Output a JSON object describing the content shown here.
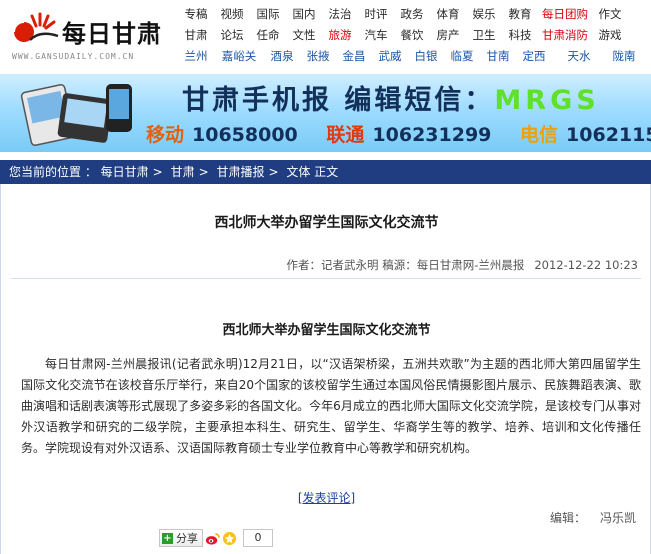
{
  "header": {
    "logo_brand": "每日甘肃",
    "logo_domain": "WWW.GANSUDAILY.COM.CN",
    "nav_rows": [
      [
        {
          "label": "专稿",
          "style": ""
        },
        {
          "label": "视频",
          "style": ""
        },
        {
          "label": "国际",
          "style": ""
        },
        {
          "label": "国内",
          "style": ""
        },
        {
          "label": "法治",
          "style": ""
        },
        {
          "label": "时评",
          "style": ""
        },
        {
          "label": "政务",
          "style": ""
        },
        {
          "label": "体育",
          "style": ""
        },
        {
          "label": "娱乐",
          "style": ""
        },
        {
          "label": "教育",
          "style": ""
        },
        {
          "label": "每日团购",
          "style": "red w3"
        },
        {
          "label": "作文",
          "style": ""
        }
      ],
      [
        {
          "label": "甘肃",
          "style": ""
        },
        {
          "label": "论坛",
          "style": ""
        },
        {
          "label": "任命",
          "style": ""
        },
        {
          "label": "文性",
          "style": ""
        },
        {
          "label": "旅游",
          "style": "red"
        },
        {
          "label": "汽车",
          "style": ""
        },
        {
          "label": "餐饮",
          "style": ""
        },
        {
          "label": "房产",
          "style": ""
        },
        {
          "label": "卫生",
          "style": ""
        },
        {
          "label": "科技",
          "style": ""
        },
        {
          "label": "甘肃消防",
          "style": "red w3"
        },
        {
          "label": "游戏",
          "style": ""
        }
      ],
      [
        {
          "label": "兰州",
          "style": "blue"
        },
        {
          "label": "嘉峪关",
          "style": "blue w2"
        },
        {
          "label": "酒泉",
          "style": "blue"
        },
        {
          "label": "张掖",
          "style": "blue"
        },
        {
          "label": "金昌",
          "style": "blue"
        },
        {
          "label": "武威",
          "style": "blue"
        },
        {
          "label": "白银",
          "style": "blue"
        },
        {
          "label": "临夏",
          "style": "blue"
        },
        {
          "label": "甘南",
          "style": "blue"
        },
        {
          "label": "定西",
          "style": "blue"
        },
        {
          "label": "天水",
          "style": "blue w3"
        },
        {
          "label": "陇南",
          "style": "blue"
        }
      ]
    ]
  },
  "banner": {
    "headline": "甘肃手机报  编辑短信：",
    "code": "MRGS",
    "carriers": [
      {
        "name": "移动",
        "number": "10658000"
      },
      {
        "name": "联通",
        "number": "106231299"
      },
      {
        "name": "电信",
        "number": "1062115"
      }
    ]
  },
  "breadcrumb": {
    "prefix": "您当前的位置 ：",
    "items": [
      "每日甘肃",
      "甘肃",
      "甘肃播报",
      "文体",
      "正文"
    ]
  },
  "article": {
    "title": "西北师大举办留学生国际文化交流节",
    "author_label": "作者：",
    "author": "记者武永明",
    "source_label": "稿源：",
    "source": "每日甘肃网-兰州晨报",
    "datetime": "2012-12-22 10:23",
    "subtitle": "西北师大举办留学生国际文化交流节",
    "body": "每日甘肃网-兰州晨报讯(记者武永明)12月21日，以“汉语架桥梁，五洲共欢歌”为主题的西北师大第四届留学生国际文化交流节在该校音乐厅举行，来自20个国家的该校留学生通过本国风俗民情摄影图片展示、民族舞蹈表演、歌曲演唱和话剧表演等形式展现了多姿多彩的各国文化。今年6月成立的西北师大国际文化交流学院，是该校专门从事对外汉语教学和研究的二级学院，主要承担本科生、研究生、留学生、华裔学生等的教学、培养、培训和文化传播任务。学院现设有对外汉语系、汉语国际教育硕士专业学位教育中心等教学和研究机构。",
    "comment_link": "[发表评论]",
    "editor_label": "编辑：",
    "editor": "冯乐凯"
  },
  "share": {
    "label": "分享",
    "count": "0",
    "icons": [
      "weibo-icon",
      "qzone-icon"
    ]
  },
  "colors": {
    "breadcrumb_bg": "#1f3d80",
    "nav_red": "#d8000c",
    "nav_blue": "#1a55a8",
    "banner_code": "#5fe02a"
  }
}
